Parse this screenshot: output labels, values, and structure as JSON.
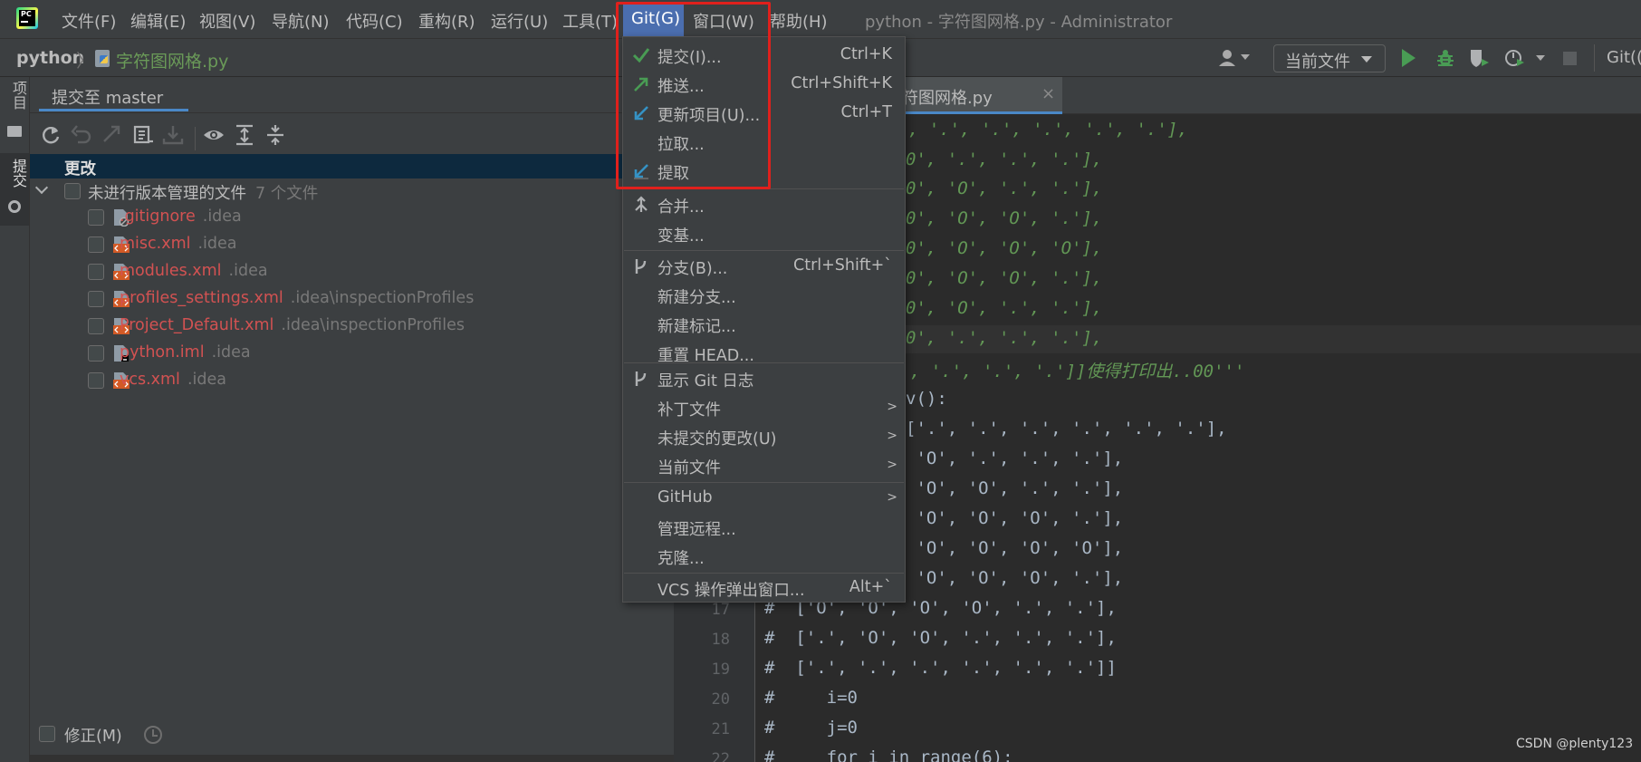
{
  "app": {
    "window_title": "python - 字符图网格.py - Administrator",
    "logo_text": "PC"
  },
  "menubar": [
    "文件(F)",
    "编辑(E)",
    "视图(V)",
    "导航(N)",
    "代码(C)",
    "重构(R)",
    "运行(U)",
    "工具(T)",
    "Git(G)",
    "窗口(W)",
    "帮助(H)"
  ],
  "navbar": {
    "project": "python",
    "file": "字符图网格.py",
    "run_config": "当前文件",
    "git_label": "Git(("
  },
  "left_strip": {
    "project_tab": "项目",
    "commit_tab": "提交"
  },
  "commit_panel": {
    "title": "提交至 master",
    "changes_header": "更改",
    "group_label": "未进行版本管理的文件",
    "group_count": "7 个文件",
    "files": [
      {
        "name": ".gitignore",
        "path": ".idea"
      },
      {
        "name": "misc.xml",
        "path": ".idea"
      },
      {
        "name": "modules.xml",
        "path": ".idea"
      },
      {
        "name": "profiles_settings.xml",
        "path": ".idea\\inspectionProfiles"
      },
      {
        "name": "Project_Default.xml",
        "path": ".idea\\inspectionProfiles"
      },
      {
        "name": "python.iml",
        "path": ".idea"
      },
      {
        "name": "vcs.xml",
        "path": ".idea"
      }
    ],
    "amend_label": "修正(M)"
  },
  "editor": {
    "tab_label": "符图网格.py",
    "code_lines": [
      ".', '.', '.', '.', '.', '.'],",
      "0', '.', '.', '.'],",
      "0', 'O', '.', '.'],",
      "0', 'O', 'O', '.'],",
      "0', 'O', 'O', 'O'],",
      "0', 'O', 'O', '.'],",
      "0', 'O', '.', '.'],",
      "0', '.', '.', '.'],",
      ".', '.', '.', '.']]使得打印出..00'''",
      "v():",
      "['.', '.', '.', '.', '.', '.'],",
      " 'O', '.', '.', '.'],",
      " 'O', 'O', '.', '.'],",
      " 'O', 'O', 'O', '.'],",
      " 'O', 'O', 'O', 'O'],",
      " 'O', 'O', 'O', '.'],",
      "#  ['O', 'O', 'O', 'O', '.', '.'],",
      "#  ['.', 'O', 'O', '.', '.', '.'],",
      "#  ['.', '.', '.', '.', '.', '.']]",
      "#     i=0",
      "#     j=0",
      "#     for i in range(6):"
    ],
    "line_numbers": [
      "17",
      "18",
      "19",
      "20",
      "21",
      "22"
    ]
  },
  "git_menu": {
    "items": [
      {
        "label": "提交(I)...",
        "shortcut": "Ctrl+K",
        "icon": "check-icon"
      },
      {
        "label": "推送...",
        "shortcut": "Ctrl+Shift+K",
        "icon": "push-arrow-icon"
      },
      {
        "label": "更新项目(U)...",
        "shortcut": "Ctrl+T",
        "icon": "update-arrow-icon"
      },
      {
        "label": "拉取...",
        "shortcut": ""
      },
      {
        "label": "提取",
        "shortcut": "",
        "icon": "fetch-arrow-icon"
      },
      {
        "label": "合并...",
        "shortcut": "",
        "icon": "merge-icon"
      },
      {
        "label": "变基...",
        "shortcut": ""
      },
      {
        "label": "分支(B)...",
        "shortcut": "Ctrl+Shift+`",
        "icon": "branch-icon"
      },
      {
        "label": "新建分支...",
        "shortcut": ""
      },
      {
        "label": "新建标记...",
        "shortcut": ""
      },
      {
        "label": "重置 HEAD...",
        "shortcut": ""
      },
      {
        "label": "显示 Git 日志",
        "shortcut": "",
        "icon": "branch-icon"
      },
      {
        "label": "补丁文件",
        "shortcut": ""
      },
      {
        "label": "未提交的更改(U)",
        "shortcut": ""
      },
      {
        "label": "当前文件",
        "shortcut": ""
      },
      {
        "label": "GitHub",
        "shortcut": ""
      },
      {
        "label": "管理远程...",
        "shortcut": ""
      },
      {
        "label": "克隆...",
        "shortcut": ""
      },
      {
        "label": "VCS 操作弹出窗口...",
        "shortcut": "Alt+`"
      }
    ]
  },
  "watermark": "CSDN @plenty123",
  "colors": {
    "accent": "#4b6eaf",
    "highlight_box": "#e0201c",
    "unversioned": "#d25252",
    "string": "#629755"
  }
}
